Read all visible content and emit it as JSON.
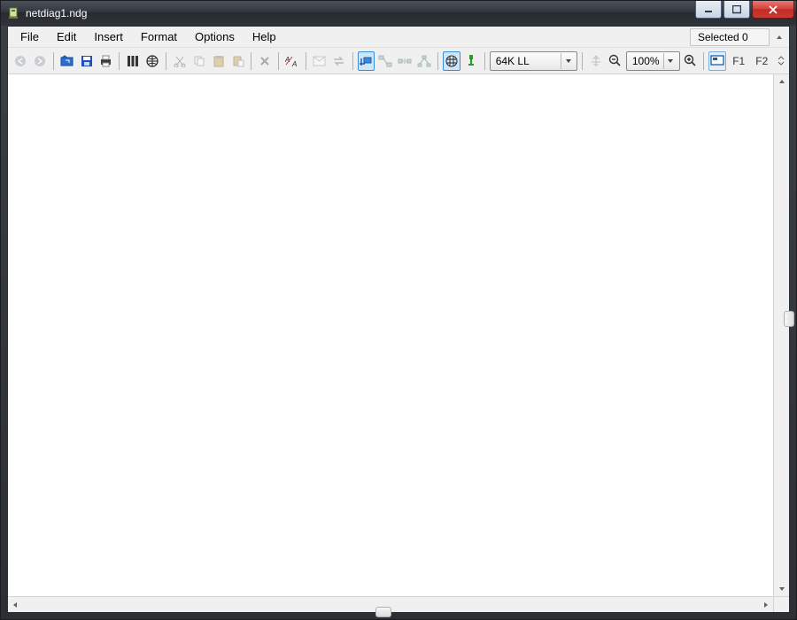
{
  "window": {
    "title": "netdiag1.ndg"
  },
  "menu": {
    "file": "File",
    "edit": "Edit",
    "insert": "Insert",
    "format": "Format",
    "options": "Options",
    "help": "Help"
  },
  "status": {
    "selected_label": "Selected 0"
  },
  "toolbar": {
    "speed_combo": {
      "value": "64K LL"
    },
    "zoom_combo": {
      "value": "100%"
    },
    "fkeys": {
      "f1": "F1",
      "f2": "F2"
    }
  },
  "icons": {
    "back": "back-arrow",
    "forward": "forward-arrow",
    "open": "folder-open",
    "save": "floppy",
    "print": "printer",
    "columns": "columns",
    "globe": "globe",
    "cut": "scissors",
    "copy": "copy",
    "paste": "paste",
    "paste_special": "paste-special",
    "delete": "delete-x",
    "ab": "format-ab",
    "email": "envelope",
    "swap": "swap-arrows",
    "add_node": "add-node",
    "relay": "nodes-linked",
    "expand": "expand-nodes",
    "cluster": "cluster-nodes",
    "grid": "grid",
    "connector": "connector-green",
    "alignment": "alignment",
    "zoom_out": "magnify-minus",
    "zoom_in": "magnify-plus",
    "screen": "screen-fit"
  }
}
